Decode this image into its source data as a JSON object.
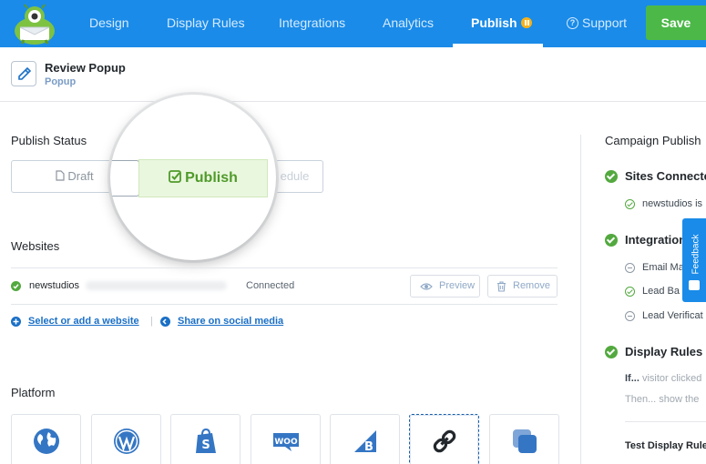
{
  "nav": {
    "items": [
      "Design",
      "Display Rules",
      "Integrations",
      "Analytics",
      "Publish"
    ],
    "support_label": "Support",
    "save_label": "Save",
    "active": "Publish",
    "accent_color": "#1a8be8"
  },
  "header": {
    "title": "Review Popup",
    "subtitle": "Popup"
  },
  "publish_status": {
    "label": "Publish Status",
    "draft_label": "Draft",
    "publish_label": "Publish",
    "schedule_partial_label": "edule"
  },
  "websites": {
    "label": "Websites",
    "site_name": "newstudios",
    "status": "Connected",
    "preview_label": "Preview",
    "remove_label": "Remove",
    "select_link": "Select or add a website",
    "share_link": "Share on social media"
  },
  "platform": {
    "label": "Platform",
    "tiles": [
      "globe-icon",
      "wordpress-icon",
      "shopify-icon",
      "woocommerce-icon",
      "bigcommerce-icon",
      "link-icon",
      "layers-icon"
    ],
    "woo_text": "WOO",
    "selected": "link-icon"
  },
  "right_panel": {
    "title": "Campaign Publish",
    "sites_heading": "Sites Connecte",
    "site_item": "newstudios is",
    "integrations_heading": "Integration",
    "integration_items": [
      "Email Ma",
      "Lead Ba",
      "Lead Verificat"
    ],
    "display_rules_heading": "Display Rules S",
    "if_prefix": "If...",
    "if_text": " visitor clicked",
    "then_prefix": "Then...",
    "then_text": " show the",
    "test_heading": "Test Display Rule"
  },
  "feedback_label": "Feedback"
}
